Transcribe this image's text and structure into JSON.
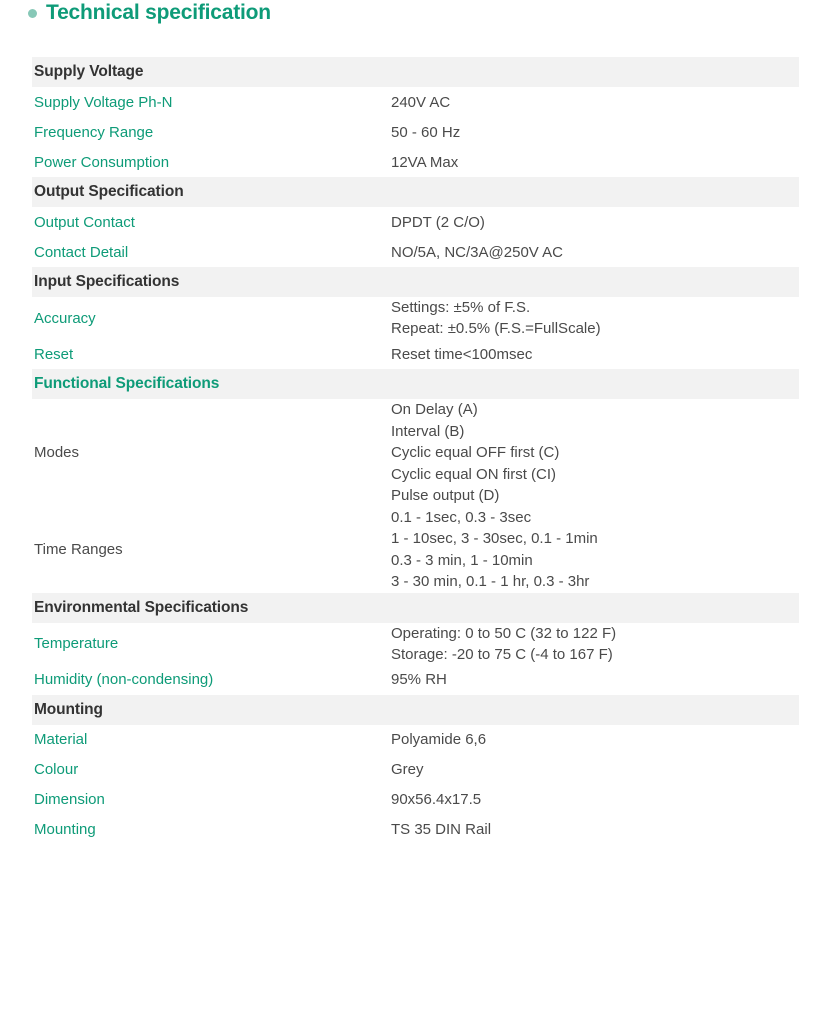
{
  "page": {
    "title": "Technical specification",
    "bullet_color": "#87c8b7",
    "accent_color": "#0e9b78",
    "header_band_color": "#f2f2f2",
    "text_color": "#4a4a4a",
    "section_header_text_color": "#333333"
  },
  "table": {
    "sections": [
      {
        "header": "Supply Voltage",
        "header_style": "dark",
        "rows": [
          {
            "label": "Supply Voltage Ph-N",
            "label_style": "teal",
            "values": [
              "240V AC"
            ]
          },
          {
            "label": "Frequency Range",
            "label_style": "teal",
            "values": [
              "50 - 60 Hz"
            ]
          },
          {
            "label": "Power Consumption",
            "label_style": "teal",
            "values": [
              "12VA Max"
            ]
          }
        ]
      },
      {
        "header": "Output Specification",
        "header_style": "dark",
        "rows": [
          {
            "label": "Output Contact",
            "label_style": "teal",
            "values": [
              "DPDT (2 C/O)"
            ]
          },
          {
            "label": "Contact Detail",
            "label_style": "teal",
            "values": [
              "NO/5A, NC/3A@250V AC"
            ]
          }
        ]
      },
      {
        "header": "Input Specifications",
        "header_style": "dark",
        "rows": [
          {
            "label": "Accuracy",
            "label_style": "teal",
            "values": [
              "Settings: ±5% of F.S.",
              "Repeat: ±0.5% (F.S.=FullScale)"
            ]
          },
          {
            "label": "Reset",
            "label_style": "teal",
            "values": [
              "Reset time<100msec"
            ]
          }
        ]
      },
      {
        "header": "Functional Specifications",
        "header_style": "teal",
        "rows": [
          {
            "label": "Modes",
            "label_style": "plain",
            "values": [
              "On Delay (A)",
              "Interval (B)",
              "Cyclic equal OFF first (C)",
              "Cyclic equal ON first (CI)",
              "Pulse output (D)"
            ]
          },
          {
            "label": "Time Ranges",
            "label_style": "plain",
            "values": [
              "0.1 - 1sec, 0.3 - 3sec",
              "1 - 10sec, 3 - 30sec, 0.1 - 1min",
              "0.3 - 3 min, 1 - 10min",
              "3 - 30 min, 0.1 - 1 hr, 0.3 - 3hr"
            ]
          }
        ]
      },
      {
        "header": "Environmental Specifications",
        "header_style": "dark",
        "rows": [
          {
            "label": "Temperature",
            "label_style": "teal",
            "values": [
              "Operating: 0 to 50 C (32 to 122 F)",
              "Storage: -20 to 75 C (-4 to 167 F)"
            ]
          },
          {
            "label": "Humidity (non-condensing)",
            "label_style": "teal",
            "values": [
              "95% RH"
            ]
          }
        ]
      },
      {
        "header": "Mounting",
        "header_style": "dark",
        "rows": [
          {
            "label": "Material",
            "label_style": "teal",
            "values": [
              "Polyamide 6,6"
            ]
          },
          {
            "label": "Colour",
            "label_style": "teal",
            "values": [
              "Grey"
            ]
          },
          {
            "label": "Dimension",
            "label_style": "teal",
            "values": [
              "90x56.4x17.5"
            ]
          },
          {
            "label": "Mounting",
            "label_style": "teal",
            "values": [
              "TS 35 DIN Rail"
            ]
          }
        ]
      }
    ]
  }
}
